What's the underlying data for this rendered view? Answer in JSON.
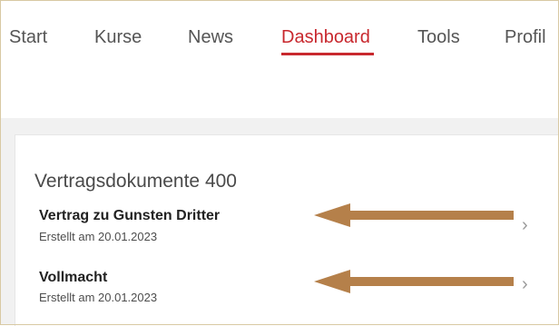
{
  "nav": {
    "items": [
      {
        "label": "Start"
      },
      {
        "label": "Kurse"
      },
      {
        "label": "News"
      },
      {
        "label": "Dashboard",
        "active": true
      },
      {
        "label": "Tools"
      },
      {
        "label": "Profil"
      }
    ]
  },
  "section": {
    "title": "Vertragsdokumente 400",
    "documents": [
      {
        "title": "Vertrag zu Gunsten Dritter",
        "meta": "Erstellt am 20.01.2023"
      },
      {
        "title": "Vollmacht",
        "meta": "Erstellt am 20.01.2023"
      }
    ]
  },
  "colors": {
    "accent": "#c8282e",
    "arrow": "#b5804a",
    "background": "#f1f1f1"
  },
  "icons": {
    "chevron": "chevron-right-icon",
    "annotation": "arrow-left-icon"
  }
}
